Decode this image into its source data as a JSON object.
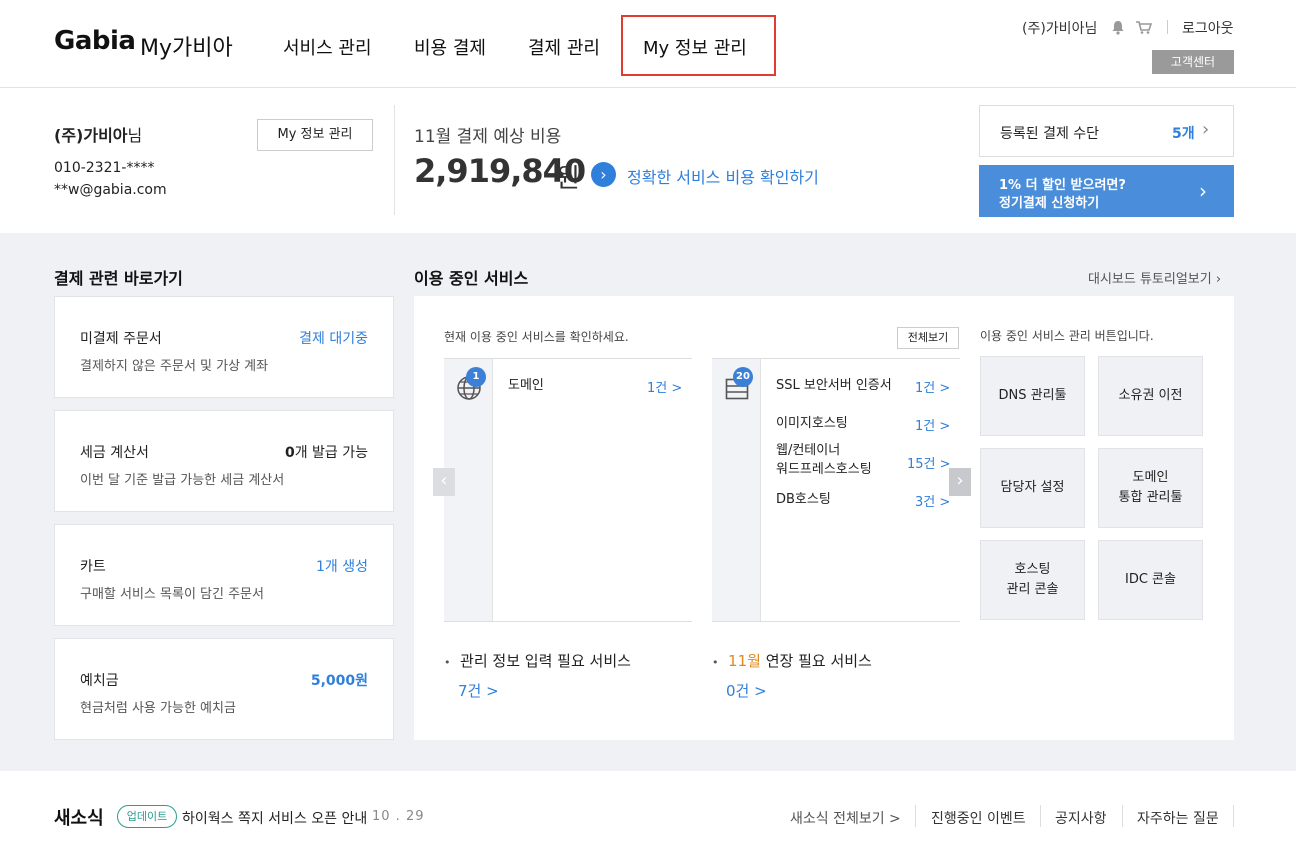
{
  "header": {
    "brand": "Gabia",
    "sub_brand": "My가비아",
    "nav": [
      "서비스 관리",
      "비용 결제",
      "결제 관리",
      "My 정보 관리"
    ],
    "active_nav": "My 정보 관리",
    "user": "(주)가비아님",
    "logout": "로그아웃",
    "support": "고객센터"
  },
  "summary": {
    "company": "(주)가비아",
    "suffix": "님",
    "phone": "010-2321-****",
    "email": "**w@gabia.com",
    "my_info_button": "My 정보 관리",
    "estimate_label": "11월 결제 예상 비용",
    "estimate_amount": "2,919,840",
    "estimate_unit": "원",
    "estimate_link": "정확한 서비스 비용 확인하기",
    "payment_methods_label": "등록된 결제 수단",
    "payment_methods_count": "5개",
    "promo_line1": "1% 더 할인 받으려면?",
    "promo_line2": "정기결제 신청하기"
  },
  "shortcuts": {
    "title": "결제 관련 바로가기",
    "cards": [
      {
        "title": "미결제 주문서",
        "desc": "결제하지 않은 주문서 및 가상 계좌",
        "status": "결제 대기중"
      },
      {
        "title": "세금 계산서",
        "desc": "이번 달 기준 발급 가능한 세금 계산서",
        "status_num": "0",
        "status_text": "개 발급 가능"
      },
      {
        "title": "카트",
        "desc": "구매할 서비스 목록이 담긴 주문서",
        "status": "1개 생성"
      },
      {
        "title": "예치금",
        "desc": "현금처럼 사용 가능한 예치금",
        "status": "5,000원"
      }
    ]
  },
  "services": {
    "title": "이용 중인 서비스",
    "tutorial_link": "대시보드 튜토리얼보기",
    "hint": "현재 이용 중인 서비스를 확인하세요.",
    "view_all": "전체보기",
    "domain_badge": "1",
    "domain_label": "도메인",
    "domain_count": "1건 >",
    "hosting_badge": "20",
    "hosting_items": [
      {
        "label": "SSL 보안서버 인증서",
        "count": "1건 >"
      },
      {
        "label": "이미지호스팅",
        "count": "1건 >"
      },
      {
        "label": "웹/컨테이너",
        "label2": "워드프레스호스팅",
        "count": "15건 >"
      },
      {
        "label": "DB호스팅",
        "count": "3건 >"
      }
    ],
    "tool_hint": "이용 중인 서비스 관리 버튼입니다.",
    "tools": [
      {
        "l1": "DNS 관리툴",
        "l2": ""
      },
      {
        "l1": "소유권 이전",
        "l2": ""
      },
      {
        "l1": "담당자 설정",
        "l2": ""
      },
      {
        "l1": "도메인",
        "l2": "통합 관리툴"
      },
      {
        "l1": "호스팅",
        "l2": "관리 콘솔"
      },
      {
        "l1": "IDC 콘솔",
        "l2": ""
      }
    ],
    "need_info_label": "관리 정보 입력 필요 서비스",
    "need_info_count": "7건 >",
    "renew_month": "11월",
    "renew_label": " 연장 필요 서비스",
    "renew_count": "0건 >"
  },
  "news": {
    "title": "새소식",
    "badge": "업데이트",
    "headline": "하이웍스 쪽지 서비스 오픈 안내",
    "date": "10 . 29",
    "links": [
      "새소식 전체보기 >",
      "진행중인 이벤트",
      "공지사항",
      "자주하는 질문"
    ]
  },
  "colors": {
    "accent": "#2f7fdb",
    "active_border": "#e03c31",
    "promo": "#4a8edb",
    "badge_green": "#2a9d8f"
  }
}
